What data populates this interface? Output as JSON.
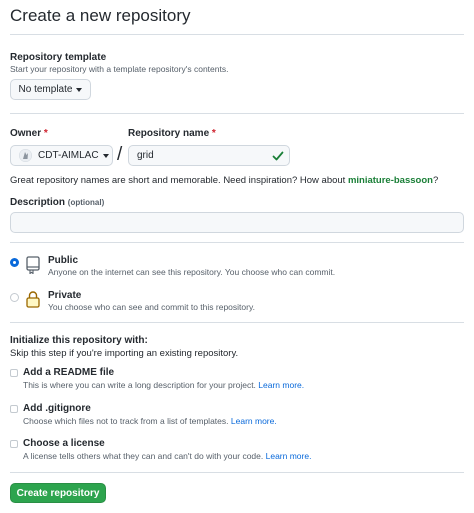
{
  "page_title": "Create a new repository",
  "template": {
    "label": "Repository template",
    "note": "Start your repository with a template repository's contents.",
    "button": "No template"
  },
  "owner": {
    "label": "Owner",
    "required": "*",
    "value": "CDT-AIMLAC"
  },
  "separator": "/",
  "repo_name": {
    "label": "Repository name",
    "required": "*",
    "value": "grid"
  },
  "name_hint": {
    "text": "Great repository names are short and memorable. Need inspiration? How about ",
    "suggestion": "miniature-bassoon",
    "tail": "?"
  },
  "description": {
    "label": "Description",
    "optional": "(optional)",
    "value": ""
  },
  "visibility": [
    {
      "title": "Public",
      "desc": "Anyone on the internet can see this repository. You choose who can commit.",
      "checked": true
    },
    {
      "title": "Private",
      "desc": "You choose who can see and commit to this repository.",
      "checked": false
    }
  ],
  "init": {
    "title": "Initialize this repository with:",
    "note": "Skip this step if you're importing an existing repository.",
    "options": [
      {
        "title": "Add a README file",
        "desc": "This is where you can write a long description for your project.",
        "link": "Learn more."
      },
      {
        "title": "Add .gitignore",
        "desc": "Choose which files not to track from a list of templates.",
        "link": "Learn more."
      },
      {
        "title": "Choose a license",
        "desc": "A license tells others what they can and can't do with your code.",
        "link": "Learn more."
      }
    ]
  },
  "submit": "Create repository",
  "colors": {
    "primary_button": "#2da44e",
    "link": "#0969da",
    "suggestion": "#1a7f37",
    "required": "#cf222e",
    "check": "#1a7f37"
  }
}
